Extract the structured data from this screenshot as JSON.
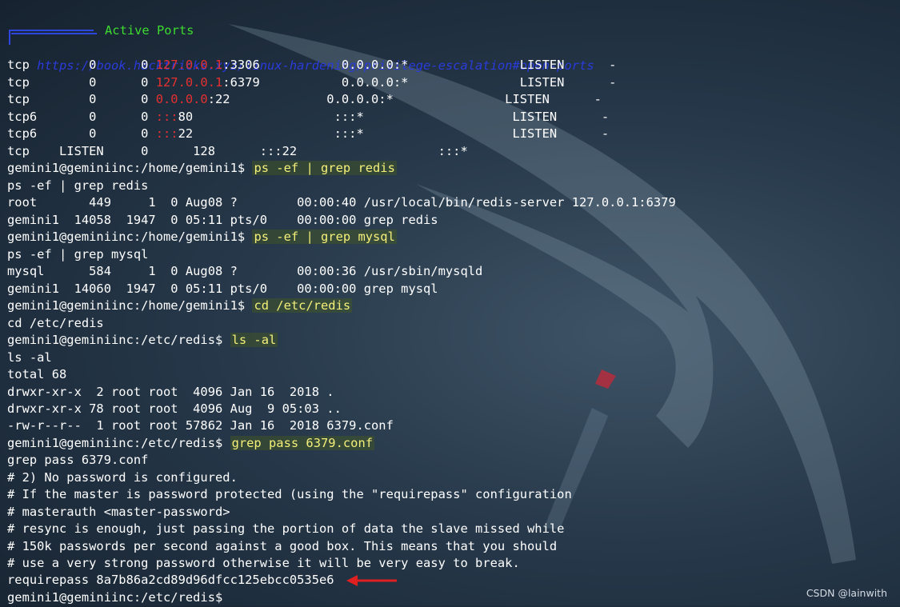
{
  "header": {
    "banner": "Active Ports",
    "url": "https://book.hacktricks.xyz/linux-hardening/privilege-escalation#open-ports"
  },
  "ports": [
    {
      "pre": "tcp        0      0 ",
      "ip": "127.0.0.1",
      "post": ":3306           0.0.0.0:*               LISTEN      -"
    },
    {
      "pre": "tcp        0      0 ",
      "ip": "127.0.0.1",
      "post": ":6379           0.0.0.0:*               LISTEN      -"
    },
    {
      "pre": "tcp        0      0 ",
      "ip": "0.0.0.0",
      "post": ":22             0.0.0.0:*               LISTEN      -"
    },
    {
      "pre": "tcp6       0      0 ",
      "ip": ":::",
      "post": "80                   :::*                    LISTEN      -"
    },
    {
      "pre": "tcp6       0      0 ",
      "ip": ":::",
      "post": "22                   :::*                    LISTEN      -"
    }
  ],
  "ss_line": "tcp    LISTEN     0      128      :::22                   :::*",
  "prompt_home": "gemini1@geminiinc:/home/gemini1$ ",
  "prompt_redis": "gemini1@geminiinc:/etc/redis$ ",
  "cmd_ps_redis": "ps -ef | grep redis",
  "cmd_ps_mysql": "ps -ef | grep mysql",
  "cmd_cd": "cd /etc/redis",
  "cmd_ls": "ls -al",
  "cmd_grep": "grep pass 6379.conf",
  "out": {
    "redis_root": "root       449     1  0 Aug08 ?        00:00:40 /usr/local/bin/redis-server 127.0.0.1:6379",
    "redis_grep": "gemini1  14058  1947  0 05:11 pts/0    00:00:00 grep redis",
    "mysql_proc": "mysql      584     1  0 Aug08 ?        00:00:36 /usr/sbin/mysqld",
    "mysql_grep": "gemini1  14060  1947  0 05:11 pts/0    00:00:00 grep mysql",
    "total": "total 68",
    "ls_dot": "drwxr-xr-x  2 root root  4096 Jan 16  2018 .",
    "ls_dotdot": "drwxr-xr-x 78 root root  4096 Aug  9 05:03 ..",
    "ls_conf": "-rw-r--r--  1 root root 57862 Jan 16  2018 6379.conf",
    "g1": "# 2) No password is configured.",
    "g2": "# If the master is password protected (using the \"requirepass\" configuration",
    "g3": "# masterauth <master-password>",
    "g4": "# resync is enough, just passing the portion of data the slave missed while",
    "g5": "# 150k passwords per second against a good box. This means that you should",
    "g6": "# use a very strong password otherwise it will be very easy to break.",
    "requirepass": "requirepass 8a7b86a2cd89d96dfcc125ebcc0535e6"
  },
  "watermark": "CSDN @lainwith",
  "colors": {
    "background": "#26384a",
    "text": "#ffffff",
    "command": "#f4f07a",
    "banner": "#3ddc2f",
    "url": "#2a3bdc",
    "ip": "#e53030",
    "arrow": "#e02020"
  },
  "icons": {
    "annotation": "red-arrow-left",
    "background_logo": "kali-dragon-logo"
  }
}
